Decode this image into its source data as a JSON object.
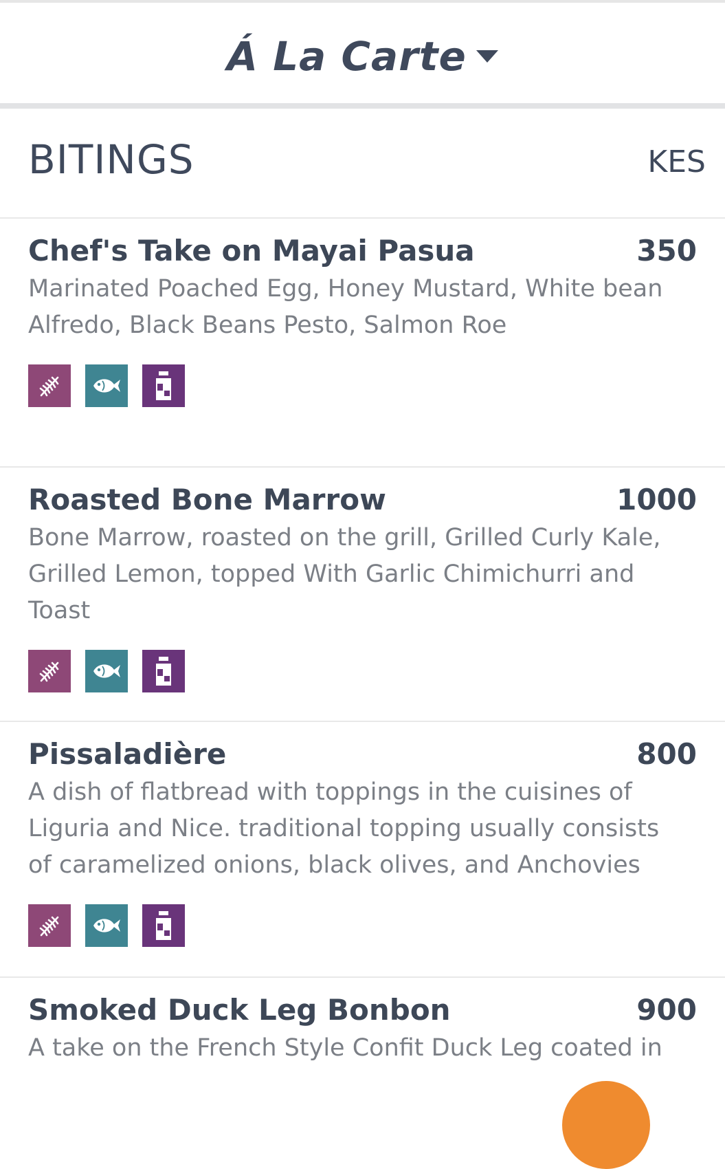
{
  "header": {
    "menu_title": "Á La Carte",
    "dropdown_icon": "caret-down-icon"
  },
  "section": {
    "title": "BITINGS",
    "currency": "KES"
  },
  "colors": {
    "text_dark": "#3d4757",
    "text_muted": "#7b7f86",
    "gluten_icon_bg": "#8e4877",
    "fish_icon_bg": "#3f8592",
    "dairy_icon_bg": "#69347a",
    "fab_accent": "#ef8b2f"
  },
  "items": [
    {
      "name": "Chef's Take on Mayai Pasua",
      "price": "350",
      "description": "Marinated Poached Egg, Honey Mustard, White bean Alfredo, Black Beans Pesto, Salmon Roe",
      "icons": [
        "wheat-icon",
        "fish-icon",
        "milk-icon"
      ]
    },
    {
      "name": "Roasted Bone Marrow",
      "price": "1000",
      "description": "Bone Marrow, roasted on the grill, Grilled Curly Kale, Grilled Lemon, topped With Garlic Chimichurri and Toast",
      "icons": [
        "wheat-icon",
        "fish-icon",
        "milk-icon"
      ]
    },
    {
      "name": "Pissaladière",
      "price": "800",
      "description": "A dish of flatbread with toppings in the cuisines of Liguria and Nice. traditional topping usually consists of caramelized onions, black olives, and Anchovies",
      "icons": [
        "wheat-icon",
        "fish-icon",
        "milk-icon"
      ]
    },
    {
      "name": "Smoked Duck Leg Bonbon",
      "price": "900",
      "description": "A take on the French Style Confit Duck Leg coated in",
      "icons": []
    }
  ]
}
